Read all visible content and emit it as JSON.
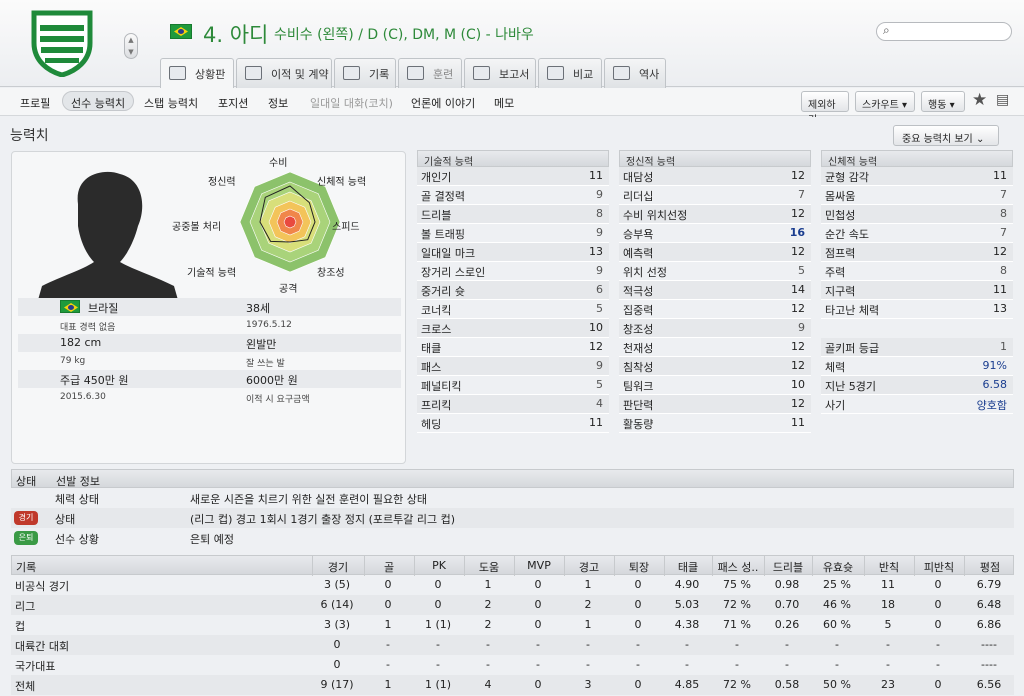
{
  "player": {
    "number_name": "4. 아디",
    "positions": "수비수 (왼쪽) / D (C), DM, M (C) - 나바우"
  },
  "search": {
    "placeholder": ""
  },
  "tabs": [
    {
      "label": "상황판"
    },
    {
      "label": "이적 및 계약"
    },
    {
      "label": "기록"
    },
    {
      "label": "훈련"
    },
    {
      "label": "보고서"
    },
    {
      "label": "비교"
    },
    {
      "label": "역사"
    }
  ],
  "subnav": {
    "items": [
      "프로필",
      "선수 능력치",
      "스탭 능력치",
      "포지션",
      "정보",
      "일대일 대화(코치)",
      "언론에 이야기",
      "메모"
    ],
    "buttons": [
      "제외하기",
      "스카우트",
      "행동"
    ]
  },
  "section": {
    "title": "능력치",
    "view_button": "중요 능력치 보기"
  },
  "radar": {
    "labels": [
      "수비",
      "신체적 능력",
      "스피드",
      "창조성",
      "공격",
      "기술적 능력",
      "공중볼 처리",
      "정신력"
    ],
    "values": [
      0.72,
      0.55,
      0.5,
      0.5,
      0.4,
      0.55,
      0.6,
      0.7
    ]
  },
  "info": {
    "nation": "브라질",
    "age": "38세",
    "caps": "대표 경력 없음",
    "dob": "1976.5.12",
    "height": "182 cm",
    "foot": "왼발만",
    "weight": "79 kg",
    "foot_note": "잘 쓰는 발",
    "wage": "주급 450만 원",
    "release": "6000만 원",
    "contract": "2015.6.30",
    "release_note": "이적 시 요구금액"
  },
  "technical": {
    "title": "기술적 능력",
    "rows": [
      [
        "개인기",
        "11"
      ],
      [
        "골 결정력",
        "9"
      ],
      [
        "드리블",
        "8"
      ],
      [
        "볼 트래핑",
        "9"
      ],
      [
        "일대일 마크",
        "13"
      ],
      [
        "장거리 스로인",
        "9"
      ],
      [
        "중거리 슛",
        "6"
      ],
      [
        "코너킥",
        "5"
      ],
      [
        "크로스",
        "10"
      ],
      [
        "태클",
        "12"
      ],
      [
        "패스",
        "9"
      ],
      [
        "페널티킥",
        "5"
      ],
      [
        "프리킥",
        "4"
      ],
      [
        "헤딩",
        "11"
      ]
    ]
  },
  "mental": {
    "title": "정신적 능력",
    "rows": [
      [
        "대담성",
        "12"
      ],
      [
        "리더십",
        "7"
      ],
      [
        "수비 위치선정",
        "12"
      ],
      [
        "승부욕",
        "16"
      ],
      [
        "예측력",
        "12"
      ],
      [
        "위치 선정",
        "5"
      ],
      [
        "적극성",
        "14"
      ],
      [
        "집중력",
        "12"
      ],
      [
        "창조성",
        "9"
      ],
      [
        "천재성",
        "12"
      ],
      [
        "침착성",
        "12"
      ],
      [
        "팀워크",
        "10"
      ],
      [
        "판단력",
        "12"
      ],
      [
        "활동량",
        "11"
      ]
    ]
  },
  "physical": {
    "title": "신체적 능력",
    "rows": [
      [
        "균형 감각",
        "11"
      ],
      [
        "몸싸움",
        "7"
      ],
      [
        "민첩성",
        "8"
      ],
      [
        "순간 속도",
        "7"
      ],
      [
        "점프력",
        "12"
      ],
      [
        "주력",
        "8"
      ],
      [
        "지구력",
        "11"
      ],
      [
        "타고난 체력",
        "13"
      ]
    ],
    "extra": [
      [
        "골키퍼 등급",
        "1"
      ],
      [
        "체력",
        "91%"
      ],
      [
        "지난 5경기",
        "6.58"
      ],
      [
        "사기",
        "양호함"
      ]
    ]
  },
  "state": {
    "h1": "상태",
    "h2": "선발 정보",
    "rows": [
      {
        "badge": "",
        "label": "체력 상태",
        "value": "새로운 시즌을 치르기 위한 실전 훈련이 필요한 상태"
      },
      {
        "badge": "경기",
        "label": "상태",
        "value": "(리그 컵) 경고 1회시 1경기 출장 정지 (포르투갈 리그 컵)"
      },
      {
        "badge": "은퇴",
        "label": "선수 상황",
        "value": "은퇴 예정"
      }
    ]
  },
  "records": {
    "headers": [
      "기록",
      "경기",
      "골",
      "PK",
      "도움",
      "MVP",
      "경고",
      "퇴장",
      "태클",
      "패스 성..",
      "드리블",
      "유효슛",
      "반칙",
      "피반칙",
      "평점"
    ],
    "rows": [
      [
        "비공식 경기",
        "3 (5)",
        "0",
        "0",
        "1",
        "0",
        "1",
        "0",
        "4.90",
        "75 %",
        "0.98",
        "25 %",
        "11",
        "0",
        "6.79"
      ],
      [
        "리그",
        "6 (14)",
        "0",
        "0",
        "2",
        "0",
        "2",
        "0",
        "5.03",
        "72 %",
        "0.70",
        "46 %",
        "18",
        "0",
        "6.48"
      ],
      [
        "컵",
        "3 (3)",
        "1",
        "1 (1)",
        "2",
        "0",
        "1",
        "0",
        "4.38",
        "71 %",
        "0.26",
        "60 %",
        "5",
        "0",
        "6.86"
      ],
      [
        "대륙간 대회",
        "0",
        "-",
        "-",
        "-",
        "-",
        "-",
        "-",
        "-",
        "-",
        "-",
        "-",
        "-",
        "-",
        "----"
      ],
      [
        "국가대표",
        "0",
        "-",
        "-",
        "-",
        "-",
        "-",
        "-",
        "-",
        "-",
        "-",
        "-",
        "-",
        "-",
        "----"
      ],
      [
        "전체",
        "9 (17)",
        "1",
        "1 (1)",
        "4",
        "0",
        "3",
        "0",
        "4.85",
        "72 %",
        "0.58",
        "50 %",
        "23",
        "0",
        "6.56"
      ]
    ]
  },
  "colors": {
    "accent_green": "#2e8a3a",
    "value_blue": "#1a3d8f",
    "badge_red": "#c0392b",
    "badge_green": "#3a9a45"
  }
}
